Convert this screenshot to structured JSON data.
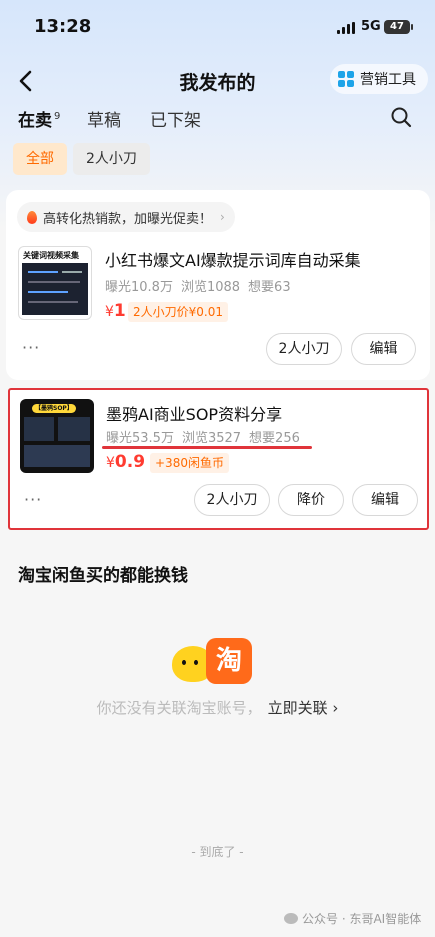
{
  "status_bar": {
    "time": "13:28",
    "network": "5G",
    "battery": "47"
  },
  "nav": {
    "title": "我发布的",
    "tool_label": "营销工具"
  },
  "tabs": [
    {
      "label": "在卖",
      "count": "9"
    },
    {
      "label": "草稿"
    },
    {
      "label": "已下架"
    }
  ],
  "filters": [
    "全部",
    "2人小刀"
  ],
  "banner": {
    "text": "高转化热销款，加曝光促卖！",
    "chevron": "›"
  },
  "items": [
    {
      "thumb_text": "关键词视频采集",
      "title": "小红书爆文AI爆款提示词库自动采集",
      "stats": [
        "曝光10.8万",
        "浏览1088",
        "想要63"
      ],
      "price_symbol": "¥",
      "price": "1",
      "tag": "2人小刀价¥0.01",
      "buttons": [
        "2人小刀",
        "编辑"
      ]
    },
    {
      "thumb_text": "【墨鸦SOP】",
      "title": "墨鸦AI商业SOP资料分享",
      "stats": [
        "曝光53.5万",
        "浏览3527",
        "想要256"
      ],
      "price_symbol": "¥",
      "price": "0.9",
      "tag": "+380闲鱼币",
      "buttons": [
        "2人小刀",
        "降价",
        "编辑"
      ]
    }
  ],
  "more_dots": "···",
  "taobao": {
    "section_title": "淘宝闲鱼买的都能换钱",
    "logo_char": "淘",
    "tip": "你还没有关联淘宝账号，",
    "link": "立即关联 ›"
  },
  "end_tip": "- 到底了 -",
  "watermark": "公众号 · 东哥AI智能体",
  "colors": {
    "accent": "#ff6a00",
    "price": "#ff3b30",
    "highlight_border": "#e0343a",
    "tool_icon": "#1ea4e8"
  }
}
